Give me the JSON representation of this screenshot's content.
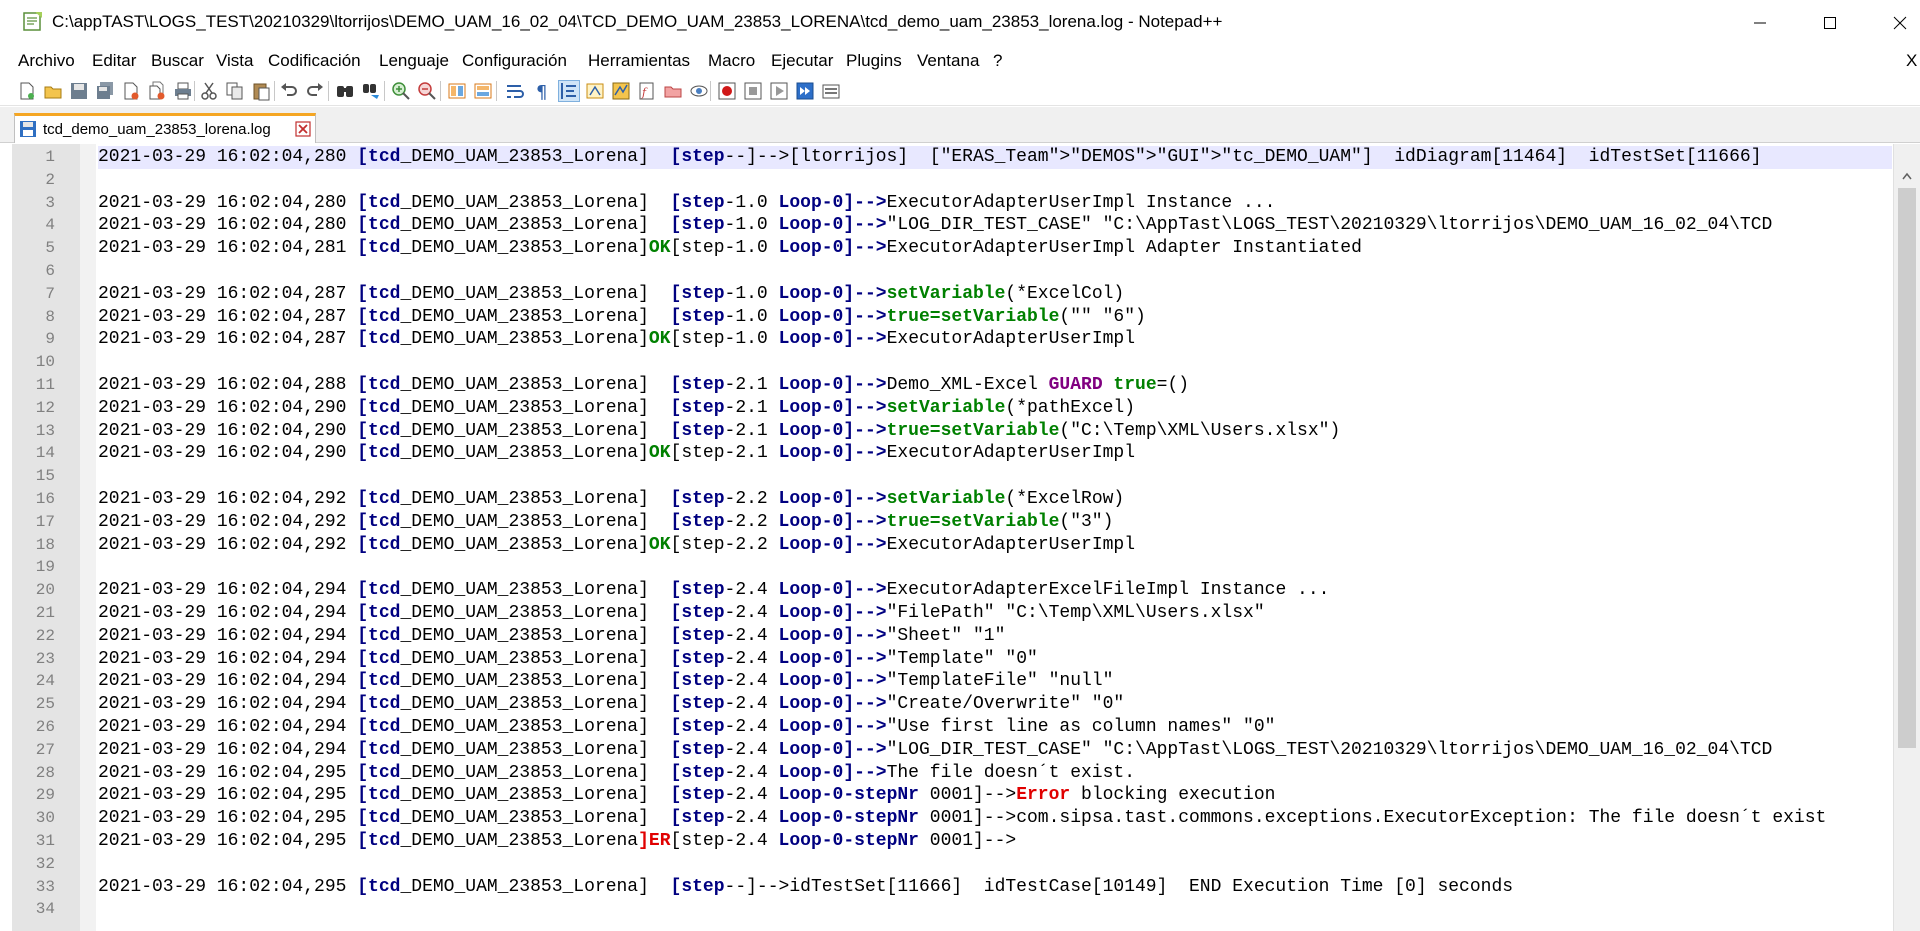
{
  "window": {
    "title": "C:\\appTAST\\LOGS_TEST\\20210329\\ltorrijos\\DEMO_UAM_16_02_04\\TCD_DEMO_UAM_23853_LORENA\\tcd_demo_uam_23853_lorena.log - Notepad++",
    "minimize": "—",
    "maximize": "☐",
    "close": "✕"
  },
  "menu": {
    "items": [
      "Archivo",
      "Editar",
      "Buscar",
      "Vista",
      "Codificación",
      "Lenguaje",
      "Configuración",
      "Herramientas",
      "Macro",
      "Ejecutar",
      "Plugins",
      "Ventana",
      "?"
    ],
    "close": "X"
  },
  "toolbar": {
    "icons": [
      "new-file-icon",
      "open-file-icon",
      "save-icon",
      "save-all-icon",
      "close-icon",
      "close-all-icon",
      "print-icon",
      "cut-icon",
      "copy-icon",
      "paste-icon",
      "undo-icon",
      "redo-icon",
      "find-icon",
      "replace-icon",
      "zoom-in-icon",
      "zoom-out-icon",
      "sync-vertical-icon",
      "sync-horizontal-icon",
      "word-wrap-icon",
      "show-all-chars-icon",
      "indent-guide-icon",
      "user-lang-icon",
      "doc-map-icon",
      "function-list-icon",
      "folder-workspace-icon",
      "monitoring-icon",
      "record-macro-icon",
      "stop-macro-icon",
      "play-macro-icon",
      "run-macro-multiple-icon",
      "save-macro-icon"
    ]
  },
  "tab": {
    "label": "tcd_demo_uam_23853_lorena.log"
  },
  "editor": {
    "lines": [
      {
        "n": "1",
        "c": [
          [
            "2021-03-29 16:02:04,280 ",
            ""
          ],
          [
            "[tcd",
            "k"
          ],
          [
            "_DEMO_UAM_23853_Lorena]  ",
            ""
          ],
          [
            "[step",
            "k"
          ],
          [
            "--]-->[ltorrijos]  [\"ERAS_Team\">\"DEMOS\">\"GUI\">\"tc_DEMO_UAM\"]  idDiagram[11464]  idTestSet[11666]",
            ""
          ]
        ]
      },
      {
        "n": "2",
        "c": []
      },
      {
        "n": "3",
        "c": [
          [
            "2021-03-29 16:02:04,280 ",
            ""
          ],
          [
            "[tcd",
            "k"
          ],
          [
            "_DEMO_UAM_23853_Lorena]  ",
            ""
          ],
          [
            "[step",
            "k"
          ],
          [
            "-1.0 ",
            ""
          ],
          [
            "Loop-0]",
            "k"
          ],
          [
            "-->",
            "k"
          ],
          [
            "ExecutorAdapterUserImpl Instance ...",
            ""
          ]
        ]
      },
      {
        "n": "4",
        "c": [
          [
            "2021-03-29 16:02:04,280 ",
            ""
          ],
          [
            "[tcd",
            "k"
          ],
          [
            "_DEMO_UAM_23853_Lorena]  ",
            ""
          ],
          [
            "[step",
            "k"
          ],
          [
            "-1.0 ",
            ""
          ],
          [
            "Loop-0]",
            "k"
          ],
          [
            "-->",
            "k"
          ],
          [
            "\"LOG_DIR_TEST_CASE\" \"C:\\AppTast\\LOGS_TEST\\20210329\\ltorrijos\\DEMO_UAM_16_02_04\\TCD",
            ""
          ]
        ]
      },
      {
        "n": "5",
        "c": [
          [
            "2021-03-29 16:02:04,281 ",
            ""
          ],
          [
            "[tcd",
            "k"
          ],
          [
            "_DEMO_UAM_23853_Lorena]",
            ""
          ],
          [
            "OK",
            "g"
          ],
          [
            "[step-1.0 ",
            ""
          ],
          [
            "Loop-0]",
            "k"
          ],
          [
            "-->",
            "k"
          ],
          [
            "ExecutorAdapterUserImpl Adapter Instantiated",
            ""
          ]
        ]
      },
      {
        "n": "6",
        "c": []
      },
      {
        "n": "7",
        "c": [
          [
            "2021-03-29 16:02:04,287 ",
            ""
          ],
          [
            "[tcd",
            "k"
          ],
          [
            "_DEMO_UAM_23853_Lorena]  ",
            ""
          ],
          [
            "[step",
            "k"
          ],
          [
            "-1.0 ",
            ""
          ],
          [
            "Loop-0]",
            "k"
          ],
          [
            "-->",
            "k"
          ],
          [
            "setVariable",
            "g"
          ],
          [
            "(*ExcelCol)",
            ""
          ]
        ]
      },
      {
        "n": "8",
        "c": [
          [
            "2021-03-29 16:02:04,287 ",
            ""
          ],
          [
            "[tcd",
            "k"
          ],
          [
            "_DEMO_UAM_23853_Lorena]  ",
            ""
          ],
          [
            "[step",
            "k"
          ],
          [
            "-1.0 ",
            ""
          ],
          [
            "Loop-0]",
            "k"
          ],
          [
            "-->",
            "k"
          ],
          [
            "true=setVariable",
            "g"
          ],
          [
            "(\"\" \"6\")",
            ""
          ]
        ]
      },
      {
        "n": "9",
        "c": [
          [
            "2021-03-29 16:02:04,287 ",
            ""
          ],
          [
            "[tcd",
            "k"
          ],
          [
            "_DEMO_UAM_23853_Lorena]",
            ""
          ],
          [
            "OK",
            "g"
          ],
          [
            "[step-1.0 ",
            ""
          ],
          [
            "Loop-0]",
            "k"
          ],
          [
            "-->",
            "k"
          ],
          [
            "ExecutorAdapterUserImpl",
            ""
          ]
        ]
      },
      {
        "n": "10",
        "c": []
      },
      {
        "n": "11",
        "c": [
          [
            "2021-03-29 16:02:04,288 ",
            ""
          ],
          [
            "[tcd",
            "k"
          ],
          [
            "_DEMO_UAM_23853_Lorena]  ",
            ""
          ],
          [
            "[step",
            "k"
          ],
          [
            "-2.1 ",
            ""
          ],
          [
            "Loop-0]",
            "k"
          ],
          [
            "-->",
            "k"
          ],
          [
            "Demo_XML-Excel ",
            ""
          ],
          [
            "GUARD ",
            "v"
          ],
          [
            "true",
            "g"
          ],
          [
            "=()",
            ""
          ]
        ]
      },
      {
        "n": "12",
        "c": [
          [
            "2021-03-29 16:02:04,290 ",
            ""
          ],
          [
            "[tcd",
            "k"
          ],
          [
            "_DEMO_UAM_23853_Lorena]  ",
            ""
          ],
          [
            "[step",
            "k"
          ],
          [
            "-2.1 ",
            ""
          ],
          [
            "Loop-0]",
            "k"
          ],
          [
            "-->",
            "k"
          ],
          [
            "setVariable",
            "g"
          ],
          [
            "(*pathExcel)",
            ""
          ]
        ]
      },
      {
        "n": "13",
        "c": [
          [
            "2021-03-29 16:02:04,290 ",
            ""
          ],
          [
            "[tcd",
            "k"
          ],
          [
            "_DEMO_UAM_23853_Lorena]  ",
            ""
          ],
          [
            "[step",
            "k"
          ],
          [
            "-2.1 ",
            ""
          ],
          [
            "Loop-0]",
            "k"
          ],
          [
            "-->",
            "k"
          ],
          [
            "true=setVariable",
            "g"
          ],
          [
            "(\"C:\\Temp\\XML\\Users.xlsx\")",
            ""
          ]
        ]
      },
      {
        "n": "14",
        "c": [
          [
            "2021-03-29 16:02:04,290 ",
            ""
          ],
          [
            "[tcd",
            "k"
          ],
          [
            "_DEMO_UAM_23853_Lorena]",
            ""
          ],
          [
            "OK",
            "g"
          ],
          [
            "[step-2.1 ",
            ""
          ],
          [
            "Loop-0]",
            "k"
          ],
          [
            "-->",
            "k"
          ],
          [
            "ExecutorAdapterUserImpl",
            ""
          ]
        ]
      },
      {
        "n": "15",
        "c": []
      },
      {
        "n": "16",
        "c": [
          [
            "2021-03-29 16:02:04,292 ",
            ""
          ],
          [
            "[tcd",
            "k"
          ],
          [
            "_DEMO_UAM_23853_Lorena]  ",
            ""
          ],
          [
            "[step",
            "k"
          ],
          [
            "-2.2 ",
            ""
          ],
          [
            "Loop-0]",
            "k"
          ],
          [
            "-->",
            "k"
          ],
          [
            "setVariable",
            "g"
          ],
          [
            "(*ExcelRow)",
            ""
          ]
        ]
      },
      {
        "n": "17",
        "c": [
          [
            "2021-03-29 16:02:04,292 ",
            ""
          ],
          [
            "[tcd",
            "k"
          ],
          [
            "_DEMO_UAM_23853_Lorena]  ",
            ""
          ],
          [
            "[step",
            "k"
          ],
          [
            "-2.2 ",
            ""
          ],
          [
            "Loop-0]",
            "k"
          ],
          [
            "-->",
            "k"
          ],
          [
            "true=setVariable",
            "g"
          ],
          [
            "(\"3\")",
            ""
          ]
        ]
      },
      {
        "n": "18",
        "c": [
          [
            "2021-03-29 16:02:04,292 ",
            ""
          ],
          [
            "[tcd",
            "k"
          ],
          [
            "_DEMO_UAM_23853_Lorena]",
            ""
          ],
          [
            "OK",
            "g"
          ],
          [
            "[step-2.2 ",
            ""
          ],
          [
            "Loop-0]",
            "k"
          ],
          [
            "-->",
            "k"
          ],
          [
            "ExecutorAdapterUserImpl",
            ""
          ]
        ]
      },
      {
        "n": "19",
        "c": []
      },
      {
        "n": "20",
        "c": [
          [
            "2021-03-29 16:02:04,294 ",
            ""
          ],
          [
            "[tcd",
            "k"
          ],
          [
            "_DEMO_UAM_23853_Lorena]  ",
            ""
          ],
          [
            "[step",
            "k"
          ],
          [
            "-2.4 ",
            ""
          ],
          [
            "Loop-0]",
            "k"
          ],
          [
            "-->",
            "k"
          ],
          [
            "ExecutorAdapterExcelFileImpl Instance ...",
            ""
          ]
        ]
      },
      {
        "n": "21",
        "c": [
          [
            "2021-03-29 16:02:04,294 ",
            ""
          ],
          [
            "[tcd",
            "k"
          ],
          [
            "_DEMO_UAM_23853_Lorena]  ",
            ""
          ],
          [
            "[step",
            "k"
          ],
          [
            "-2.4 ",
            ""
          ],
          [
            "Loop-0]",
            "k"
          ],
          [
            "-->",
            "k"
          ],
          [
            "\"FilePath\" \"C:\\Temp\\XML\\Users.xlsx\"",
            ""
          ]
        ]
      },
      {
        "n": "22",
        "c": [
          [
            "2021-03-29 16:02:04,294 ",
            ""
          ],
          [
            "[tcd",
            "k"
          ],
          [
            "_DEMO_UAM_23853_Lorena]  ",
            ""
          ],
          [
            "[step",
            "k"
          ],
          [
            "-2.4 ",
            ""
          ],
          [
            "Loop-0]",
            "k"
          ],
          [
            "-->",
            "k"
          ],
          [
            "\"Sheet\" \"1\"",
            ""
          ]
        ]
      },
      {
        "n": "23",
        "c": [
          [
            "2021-03-29 16:02:04,294 ",
            ""
          ],
          [
            "[tcd",
            "k"
          ],
          [
            "_DEMO_UAM_23853_Lorena]  ",
            ""
          ],
          [
            "[step",
            "k"
          ],
          [
            "-2.4 ",
            ""
          ],
          [
            "Loop-0]",
            "k"
          ],
          [
            "-->",
            "k"
          ],
          [
            "\"Template\" \"0\"",
            ""
          ]
        ]
      },
      {
        "n": "24",
        "c": [
          [
            "2021-03-29 16:02:04,294 ",
            ""
          ],
          [
            "[tcd",
            "k"
          ],
          [
            "_DEMO_UAM_23853_Lorena]  ",
            ""
          ],
          [
            "[step",
            "k"
          ],
          [
            "-2.4 ",
            ""
          ],
          [
            "Loop-0]",
            "k"
          ],
          [
            "-->",
            "k"
          ],
          [
            "\"TemplateFile\" \"null\"",
            ""
          ]
        ]
      },
      {
        "n": "25",
        "c": [
          [
            "2021-03-29 16:02:04,294 ",
            ""
          ],
          [
            "[tcd",
            "k"
          ],
          [
            "_DEMO_UAM_23853_Lorena]  ",
            ""
          ],
          [
            "[step",
            "k"
          ],
          [
            "-2.4 ",
            ""
          ],
          [
            "Loop-0]",
            "k"
          ],
          [
            "-->",
            "k"
          ],
          [
            "\"Create/Overwrite\" \"0\"",
            ""
          ]
        ]
      },
      {
        "n": "26",
        "c": [
          [
            "2021-03-29 16:02:04,294 ",
            ""
          ],
          [
            "[tcd",
            "k"
          ],
          [
            "_DEMO_UAM_23853_Lorena]  ",
            ""
          ],
          [
            "[step",
            "k"
          ],
          [
            "-2.4 ",
            ""
          ],
          [
            "Loop-0]",
            "k"
          ],
          [
            "-->",
            "k"
          ],
          [
            "\"Use first line as column names\" \"0\"",
            ""
          ]
        ]
      },
      {
        "n": "27",
        "c": [
          [
            "2021-03-29 16:02:04,294 ",
            ""
          ],
          [
            "[tcd",
            "k"
          ],
          [
            "_DEMO_UAM_23853_Lorena]  ",
            ""
          ],
          [
            "[step",
            "k"
          ],
          [
            "-2.4 ",
            ""
          ],
          [
            "Loop-0]",
            "k"
          ],
          [
            "-->",
            "k"
          ],
          [
            "\"LOG_DIR_TEST_CASE\" \"C:\\AppTast\\LOGS_TEST\\20210329\\ltorrijos\\DEMO_UAM_16_02_04\\TCD",
            ""
          ]
        ]
      },
      {
        "n": "28",
        "c": [
          [
            "2021-03-29 16:02:04,295 ",
            ""
          ],
          [
            "[tcd",
            "k"
          ],
          [
            "_DEMO_UAM_23853_Lorena]  ",
            ""
          ],
          [
            "[step",
            "k"
          ],
          [
            "-2.4 ",
            ""
          ],
          [
            "Loop-0]",
            "k"
          ],
          [
            "-->",
            "k"
          ],
          [
            "The file doesn´t exist.",
            ""
          ]
        ]
      },
      {
        "n": "29",
        "c": [
          [
            "2021-03-29 16:02:04,295 ",
            ""
          ],
          [
            "[tcd",
            "k"
          ],
          [
            "_DEMO_UAM_23853_Lorena]  ",
            ""
          ],
          [
            "[step",
            "k"
          ],
          [
            "-2.4 ",
            ""
          ],
          [
            "Loop-0-stepNr",
            "k"
          ],
          [
            " 0001]-->",
            ""
          ],
          [
            "Error",
            "e"
          ],
          [
            " blocking execution",
            ""
          ]
        ]
      },
      {
        "n": "30",
        "c": [
          [
            "2021-03-29 16:02:04,295 ",
            ""
          ],
          [
            "[tcd",
            "k"
          ],
          [
            "_DEMO_UAM_23853_Lorena]  ",
            ""
          ],
          [
            "[step",
            "k"
          ],
          [
            "-2.4 ",
            ""
          ],
          [
            "Loop-0-stepNr",
            "k"
          ],
          [
            " 0001]-->com.sipsa.tast.commons.exceptions.ExecutorException: The file doesn´t exist",
            ""
          ]
        ]
      },
      {
        "n": "31",
        "c": [
          [
            "2021-03-29 16:02:04,295 ",
            ""
          ],
          [
            "[tcd",
            "k"
          ],
          [
            "_DEMO_UAM_23853_Lorena",
            ""
          ],
          [
            "]ER",
            "e"
          ],
          [
            "[step-2.4 ",
            ""
          ],
          [
            "Loop-0-stepNr",
            "k"
          ],
          [
            " 0001]-->",
            ""
          ]
        ]
      },
      {
        "n": "32",
        "c": []
      },
      {
        "n": "33",
        "c": [
          [
            "2021-03-29 16:02:04,295 ",
            ""
          ],
          [
            "[tcd",
            "k"
          ],
          [
            "_DEMO_UAM_23853_Lorena]  ",
            ""
          ],
          [
            "[step",
            "k"
          ],
          [
            "--]-->idTestSet[11666]  idTestCase[10149]  END Execution Time [0] seconds",
            ""
          ]
        ]
      },
      {
        "n": "34",
        "c": []
      }
    ]
  }
}
